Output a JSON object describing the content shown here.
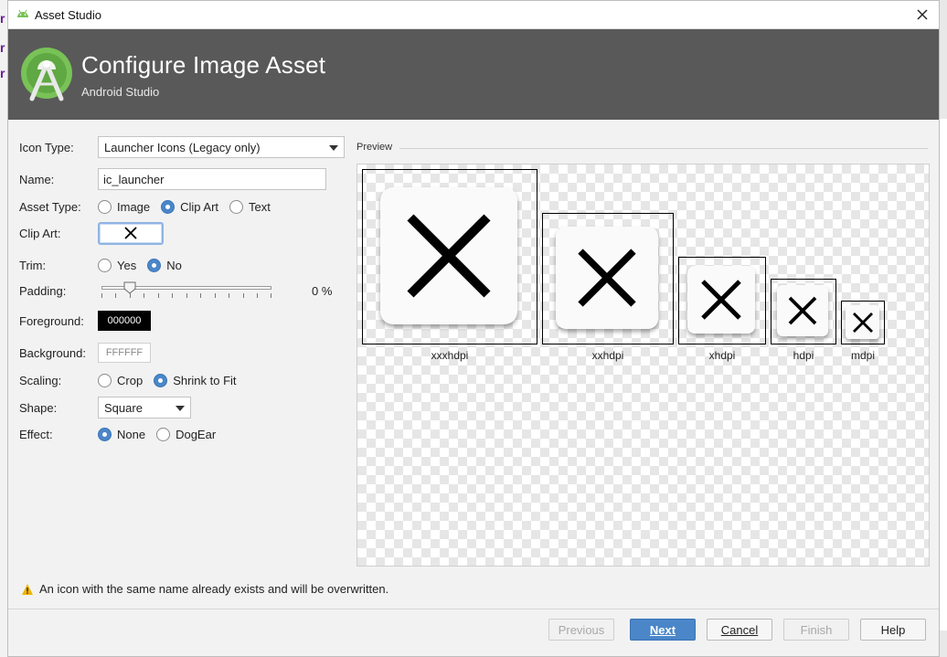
{
  "window": {
    "title": "Asset Studio",
    "header_title": "Configure Image Asset",
    "header_subtitle": "Android Studio"
  },
  "form": {
    "icon_type": {
      "label": "Icon Type:",
      "value": "Launcher Icons (Legacy only)"
    },
    "name": {
      "label": "Name:",
      "value": "ic_launcher"
    },
    "asset_type": {
      "label": "Asset Type:",
      "options": [
        "Image",
        "Clip Art",
        "Text"
      ],
      "selected": "Clip Art"
    },
    "clip_art": {
      "label": "Clip Art:",
      "icon": "close-icon"
    },
    "trim": {
      "label": "Trim:",
      "options": [
        "Yes",
        "No"
      ],
      "selected": "No"
    },
    "padding": {
      "label": "Padding:",
      "value_text": "0 %",
      "value": 0
    },
    "foreground": {
      "label": "Foreground:",
      "color": "000000"
    },
    "background": {
      "label": "Background:",
      "color": "FFFFFF"
    },
    "scaling": {
      "label": "Scaling:",
      "options": [
        "Crop",
        "Shrink to Fit"
      ],
      "selected": "Shrink to Fit"
    },
    "shape": {
      "label": "Shape:",
      "value": "Square"
    },
    "effect": {
      "label": "Effect:",
      "options": [
        "None",
        "DogEar"
      ],
      "selected": "None"
    }
  },
  "preview": {
    "title": "Preview",
    "densities": [
      "xxxhdpi",
      "xxhdpi",
      "xhdpi",
      "hdpi",
      "mdpi"
    ]
  },
  "warning": "An icon with the same name already exists and will be overwritten.",
  "buttons": {
    "previous": "Previous",
    "next": "Next",
    "cancel": "Cancel",
    "finish": "Finish",
    "help": "Help"
  },
  "colors": {
    "header_bg": "#595959",
    "accent": "#4a86c8",
    "android_green": "#78c257"
  }
}
